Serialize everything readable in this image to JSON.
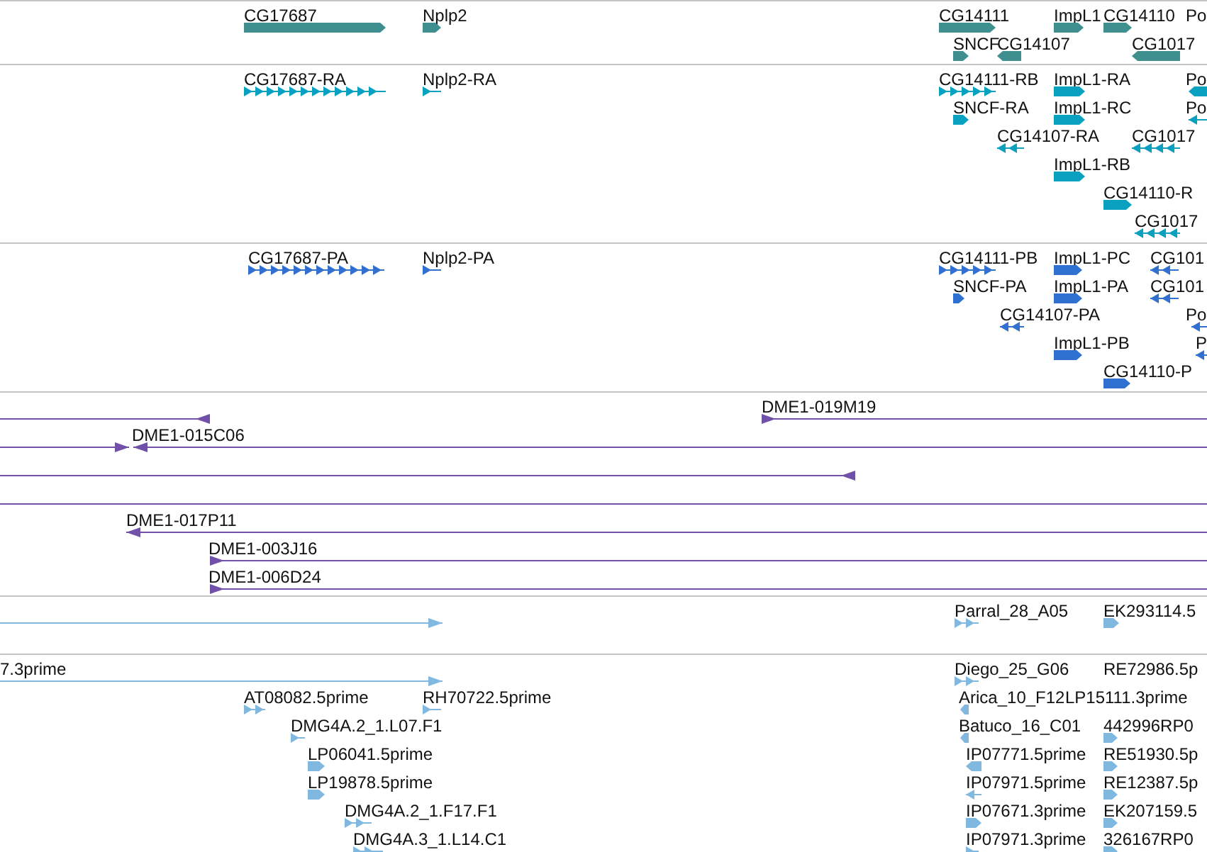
{
  "tracks": [
    {
      "color": "#3f8f8f",
      "features": [
        {
          "label": "CG17687",
          "kind": "gene",
          "reverse": false
        },
        {
          "label": "Nplp2",
          "kind": "gene",
          "reverse": false
        },
        {
          "label": "CG14111",
          "kind": "gene",
          "reverse": false
        },
        {
          "label": "ImpL1",
          "kind": "gene",
          "reverse": false
        },
        {
          "label": "CG14110",
          "kind": "gene",
          "reverse": false
        },
        {
          "label": "Po"
        },
        {
          "label": "SNCF",
          "kind": "gene",
          "reverse": false
        },
        {
          "label": "CG14107",
          "kind": "gene",
          "reverse": true
        },
        {
          "label": "CG1017",
          "kind": "gene",
          "reverse": true
        }
      ]
    },
    {
      "color": "#0aa0c0",
      "features": [
        {
          "label": "CG17687-RA",
          "kind": "transcript",
          "reverse": false
        },
        {
          "label": "Nplp2-RA",
          "kind": "transcript",
          "reverse": false
        },
        {
          "label": "CG14111-RB",
          "kind": "transcript",
          "reverse": false
        },
        {
          "label": "ImpL1-RA",
          "kind": "gene",
          "reverse": false
        },
        {
          "label": "Po",
          "kind": "gene",
          "reverse": true
        },
        {
          "label": "SNCF-RA",
          "kind": "gene",
          "reverse": false
        },
        {
          "label": "ImpL1-RC",
          "kind": "gene",
          "reverse": false
        },
        {
          "label": "Po",
          "kind": "transcript",
          "reverse": true
        },
        {
          "label": "CG14107-RA",
          "kind": "transcript",
          "reverse": true
        },
        {
          "label": "CG1017",
          "kind": "transcript",
          "reverse": true
        },
        {
          "label": "ImpL1-RB",
          "kind": "gene",
          "reverse": false
        },
        {
          "label": "CG14110-R",
          "kind": "gene",
          "reverse": false
        },
        {
          "label": "CG1017",
          "kind": "transcript",
          "reverse": true
        }
      ]
    },
    {
      "color": "#3070d0",
      "features": [
        {
          "label": "CG17687-PA",
          "kind": "transcript",
          "reverse": false
        },
        {
          "label": "Nplp2-PA",
          "kind": "transcript",
          "reverse": false
        },
        {
          "label": "CG14111-PB",
          "kind": "transcript",
          "reverse": false
        },
        {
          "label": "ImpL1-PC",
          "kind": "gene",
          "reverse": false
        },
        {
          "label": "CG101",
          "kind": "transcript",
          "reverse": true
        },
        {
          "label": "SNCF-PA",
          "kind": "gene",
          "reverse": false
        },
        {
          "label": "ImpL1-PA",
          "kind": "gene",
          "reverse": false
        },
        {
          "label": "CG101",
          "kind": "transcript",
          "reverse": true
        },
        {
          "label": "CG14107-PA",
          "kind": "transcript",
          "reverse": true
        },
        {
          "label": "Po",
          "kind": "transcript",
          "reverse": true
        },
        {
          "label": "ImpL1-PB",
          "kind": "gene",
          "reverse": false
        },
        {
          "label": "P",
          "kind": "transcript",
          "reverse": true
        },
        {
          "label": "CG14110-P",
          "kind": "gene",
          "reverse": false
        }
      ]
    },
    {
      "color": "#7050a8",
      "features": [
        {
          "kind": "clone",
          "reverse": true
        },
        {
          "label": "DME1-019M19",
          "kind": "clone",
          "reverse": false
        },
        {
          "kind": "clone",
          "reverse": false
        },
        {
          "label": "DME1-015C06",
          "kind": "clone",
          "reverse": true
        },
        {
          "kind": "clone",
          "reverse": true
        },
        {
          "kind": "clone"
        },
        {
          "label": "DME1-017P11",
          "kind": "clone",
          "reverse": true
        },
        {
          "label": "DME1-003J16",
          "kind": "clone",
          "reverse": false
        },
        {
          "label": "DME1-006D24",
          "kind": "clone",
          "reverse": false
        }
      ]
    },
    {
      "color": "#80b8e0",
      "features": [
        {
          "kind": "clone",
          "reverse": false
        },
        {
          "label": "Parral_28_A05",
          "kind": "transcript",
          "reverse": false
        },
        {
          "label": "EK293114.5",
          "kind": "gene",
          "reverse": false
        }
      ]
    },
    {
      "color": "#80b8e0",
      "features": [
        {
          "label": "7.3prime",
          "kind": "clone",
          "reverse": false
        },
        {
          "label": "Diego_25_G06",
          "kind": "transcript",
          "reverse": false
        },
        {
          "label": "RE72986.5p"
        },
        {
          "label": "AT08082.5prime",
          "kind": "transcript",
          "reverse": false
        },
        {
          "label": "RH70722.5prime",
          "kind": "transcript",
          "reverse": false
        },
        {
          "label": "Arica_10_F12",
          "kind": "gene",
          "reverse": true
        },
        {
          "label": "LP15111.3prime"
        },
        {
          "label": "DMG4A.2_1.L07.F1",
          "kind": "transcript",
          "reverse": false
        },
        {
          "label": "Batuco_16_C01",
          "kind": "gene",
          "reverse": true
        },
        {
          "label": "442996RP0",
          "kind": "gene",
          "reverse": false
        },
        {
          "label": "LP06041.5prime",
          "kind": "gene",
          "reverse": false
        },
        {
          "label": "IP07771.5prime",
          "kind": "gene",
          "reverse": true
        },
        {
          "label": "RE51930.5p",
          "kind": "gene",
          "reverse": false
        },
        {
          "label": "LP19878.5prime",
          "kind": "gene",
          "reverse": false
        },
        {
          "label": "IP07971.5prime",
          "kind": "transcript",
          "reverse": true
        },
        {
          "label": "RE12387.5p",
          "kind": "gene",
          "reverse": false
        },
        {
          "label": "DMG4A.2_1.F17.F1",
          "kind": "transcript",
          "reverse": false
        },
        {
          "label": "IP07671.3prime",
          "kind": "gene",
          "reverse": false
        },
        {
          "label": "EK207159.5",
          "kind": "gene",
          "reverse": false
        },
        {
          "label": "DMG4A.3_1.L14.C1",
          "kind": "transcript",
          "reverse": false
        },
        {
          "label": "IP07971.3prime",
          "kind": "transcript",
          "reverse": false
        },
        {
          "label": "326167RP0",
          "kind": "gene",
          "reverse": false
        }
      ]
    }
  ]
}
